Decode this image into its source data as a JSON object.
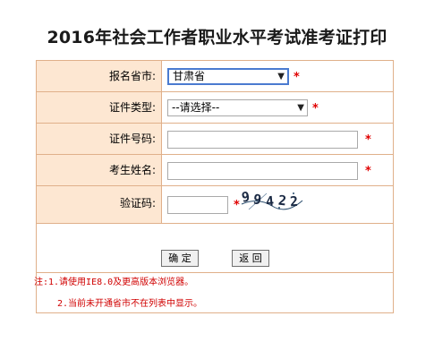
{
  "page": {
    "title": "2016年社会工作者职业水平考试准考证打印"
  },
  "form": {
    "province": {
      "label": "报名省市:",
      "selected": "甘肃省"
    },
    "cert_type": {
      "label": "证件类型:",
      "selected": "--请选择--"
    },
    "cert_number": {
      "label": "证件号码:",
      "value": ""
    },
    "name": {
      "label": "考生姓名:",
      "value": ""
    },
    "captcha": {
      "label": "验证码:",
      "value": "",
      "code_chars": [
        "9",
        "9",
        "4",
        "2",
        "2"
      ]
    },
    "required_mark": "*"
  },
  "buttons": {
    "confirm": "确 定",
    "back": "返 回"
  },
  "notes": {
    "line1": "注:1.请使用IE8.0及更高版本浏览器。",
    "line2": "2.当前未开通省市不在列表中显示。"
  },
  "colors": {
    "label_bg": "#fde7d2",
    "border": "#e0b08a",
    "required": "#e00000",
    "note": "#d00000"
  },
  "icons": {
    "dropdown": "chevron-down-icon"
  }
}
